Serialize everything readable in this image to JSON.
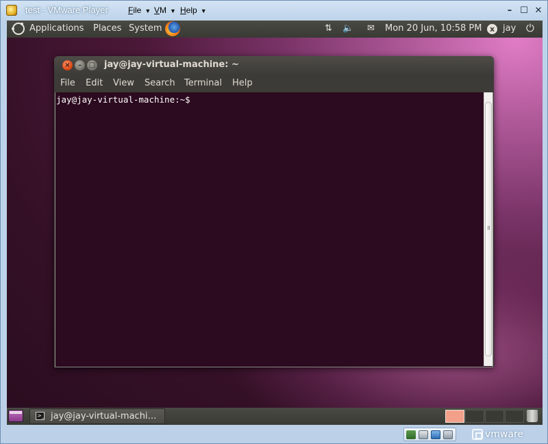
{
  "host": {
    "title": "test - VMware Player",
    "menus": [
      {
        "underline": "F",
        "rest": "ile"
      },
      {
        "underline": "V",
        "rest": "M"
      },
      {
        "underline": "H",
        "rest": "elp"
      }
    ],
    "buttons": {
      "minimize": "–",
      "maximize": "☐",
      "close": "✕"
    }
  },
  "top_panel": {
    "menus": [
      "Applications",
      "Places",
      "System"
    ],
    "tray": {
      "network": "⇅",
      "volume": "🔈",
      "mail": "✉"
    },
    "clock": "Mon 20 Jun, 10:58 PM",
    "user": "jay",
    "user_icon": "x",
    "power": "⏻"
  },
  "terminal": {
    "title": "jay@jay-virtual-machine: ~",
    "buttons": {
      "close": "×",
      "minimize": "–",
      "maximize": "□"
    },
    "menus": [
      "File",
      "Edit",
      "View",
      "Search",
      "Terminal",
      "Help"
    ],
    "prompt": "jay@jay-virtual-machine:~$"
  },
  "bottom_panel": {
    "task_label": "jay@jay-virtual-machi…",
    "task_icon": ">_",
    "workspaces": 4,
    "active_workspace": 1
  },
  "status_bar": {
    "brand": "vmware",
    "devices": [
      "network-adapter-icon",
      "hard-disk-icon",
      "display-icon",
      "sound-icon"
    ]
  },
  "colors": {
    "terminal_bg": "#2c0a1f",
    "panel_bg": "#3c3b37",
    "close_button": "#df4b16"
  }
}
